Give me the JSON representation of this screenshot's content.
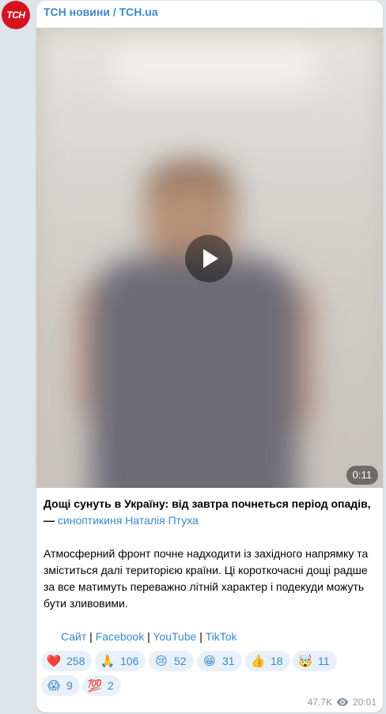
{
  "channel": {
    "avatar_text": "ТСН",
    "name": "ТСН новини / TCH.ua"
  },
  "video": {
    "duration": "0:11"
  },
  "post": {
    "headline": "Дощі сунуть в Україну: від завтра почнеться період опадів,",
    "dash": " — ",
    "author_link": "синоптикиня Наталія Птуха",
    "body": "Атмосферний фронт почне надходити із західного напрямку та зміститься далі територією країни. Ці короткочасні дощі радше за все матимуть переважно літній характер і подекуди можуть бути зливовими.",
    "links": {
      "site": "Сайт",
      "facebook": "Facebook",
      "youtube": "YouTube",
      "tiktok": "TikTok",
      "separator": " | "
    }
  },
  "reactions": [
    {
      "emoji": "❤️",
      "count": "258"
    },
    {
      "emoji": "🙏",
      "count": "106"
    },
    {
      "emoji": "😢",
      "count": "52"
    },
    {
      "emoji": "😁",
      "count": "31"
    },
    {
      "emoji": "👍",
      "count": "18"
    },
    {
      "emoji": "🤯",
      "count": "11"
    },
    {
      "emoji": "😱",
      "count": "9"
    },
    {
      "emoji": "💯",
      "count": "2"
    }
  ],
  "meta": {
    "views": "47.7K",
    "time": "20:01",
    "views_icon": "eye-icon"
  },
  "colors": {
    "accent": "#3a89c9",
    "brand": "#d4131f",
    "background": "#dde4ea"
  }
}
